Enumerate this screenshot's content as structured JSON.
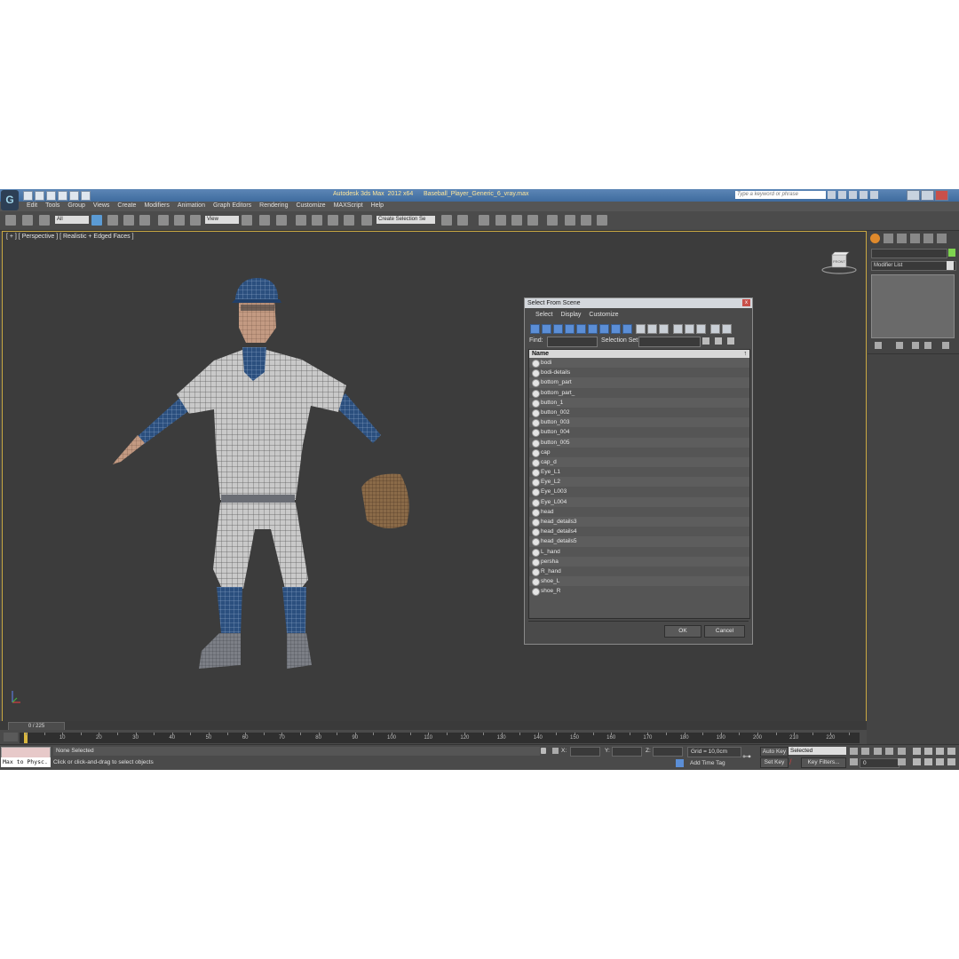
{
  "app": {
    "title": "Autodesk 3ds Max  2012 x64      Baseball_Player_Generic_6_vray.max",
    "search_placeholder": "Type a keyword or phrase",
    "logo_glyph": "G"
  },
  "menu": [
    "Edit",
    "Tools",
    "Group",
    "Views",
    "Create",
    "Modifiers",
    "Animation",
    "Graph Editors",
    "Rendering",
    "Customize",
    "MAXScript",
    "Help"
  ],
  "toolbar": {
    "filter_value": "All",
    "refcoord_value": "View",
    "selection_set_value": "Create Selection Se"
  },
  "viewport": {
    "label": "[ + ] [ Perspective ] [ Realistic + Edged Faces ]",
    "viewcube_label": "FRONT"
  },
  "dialog": {
    "title": "Select From Scene",
    "close_glyph": "x",
    "menu": [
      "Select",
      "Display",
      "Customize"
    ],
    "find_label": "Find:",
    "selection_set_label": "Selection Set:",
    "column_header": "Name",
    "sort_glyph": "↑",
    "items": [
      "bodi",
      "bodi-details",
      "bottom_part",
      "bottom_part_",
      "button_1",
      "button_002",
      "button_003",
      "button_004",
      "button_005",
      "cap",
      "cap_d",
      "Eye_L1",
      "Eye_L2",
      "Eye_L003",
      "Eye_L004",
      "head",
      "head_details3",
      "head_details4",
      "head_details5",
      "L_hand",
      "persha",
      "R_hand",
      "shoe_L",
      "shoe_R"
    ],
    "ok_label": "OK",
    "cancel_label": "Cancel"
  },
  "command_panel": {
    "modifier_list": "Modifier List",
    "object_color": "#7ed24f"
  },
  "timeline": {
    "frame_display": "0 / 225",
    "ticks": [
      10,
      20,
      30,
      40,
      50,
      60,
      70,
      80,
      90,
      100,
      110,
      120,
      130,
      140,
      150,
      160,
      170,
      180,
      190,
      200,
      210,
      220
    ]
  },
  "status": {
    "maxscript": "Max to Physc.",
    "selection": "None Selected",
    "prompt": "Click or click-and-drag to select objects",
    "x_label": "X:",
    "y_label": "Y:",
    "z_label": "Z:",
    "grid": "Grid = 10,0cm",
    "add_time_tag": "Add Time Tag",
    "auto_key": "Auto Key",
    "set_key": "Set Key",
    "selected": "Selected",
    "key_filters": "Key Filters...",
    "current_frame": "0"
  }
}
